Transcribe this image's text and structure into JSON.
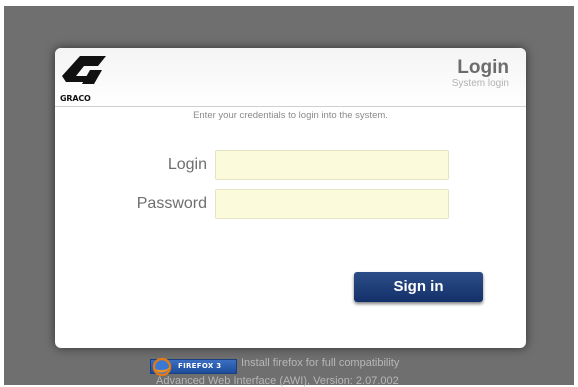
{
  "brand": {
    "logo_text": "GRACO",
    "logo_color": "#111111"
  },
  "header": {
    "title": "Login",
    "subtitle": "System login"
  },
  "form": {
    "instruction": "Enter your credentials to login into the system.",
    "login_label": "Login",
    "login_value": "",
    "password_label": "Password",
    "password_value": "",
    "submit_label": "Sign in",
    "input_background": "#fbfbdc",
    "button_color": "#1f3e78"
  },
  "footer": {
    "badge_label": "FIREFOX 3",
    "badge_icon": "firefox-icon",
    "firefox_message": "Install firefox for full compatibility",
    "version_text": "Advanced Web Interface (AWI), Version: 2.07.002"
  },
  "colors": {
    "backdrop": "#6f6f6f",
    "card": "#ffffff",
    "footer_text": "#b7b7b7"
  }
}
